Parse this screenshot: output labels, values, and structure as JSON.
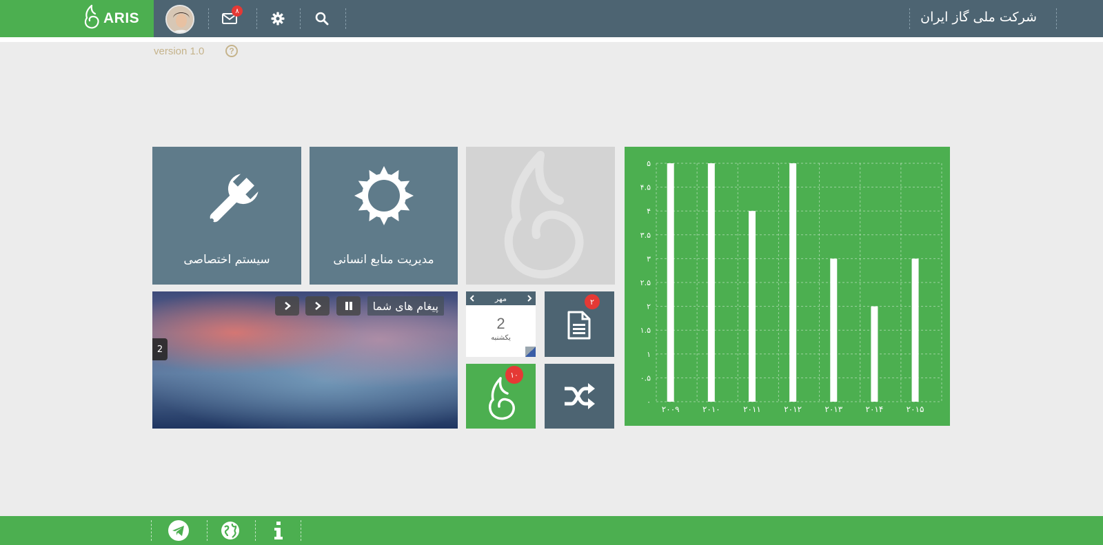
{
  "header": {
    "brand_text": "ARIS",
    "mail_count": "۸",
    "company_name": "شرکت ملی گاز ایران"
  },
  "version": {
    "label": "version 1.0",
    "help_symbol": "?"
  },
  "tiles": {
    "custom_system": {
      "label": "سیستم اختصاصی",
      "icon": "wrench-icon"
    },
    "hr_management": {
      "label": "مدیریت منابع انسانی",
      "icon": "sun-icon"
    },
    "documents": {
      "badge": "۲",
      "icon": "document-icon"
    },
    "aris_app": {
      "badge": "۱۰",
      "icon": "aris-logo-icon"
    },
    "shuffle": {
      "icon": "shuffle-icon"
    }
  },
  "slider": {
    "title": "پیغام های شما",
    "counter": "2"
  },
  "calendar": {
    "month": "مهر",
    "day": "2",
    "weekday": "یکشنبه"
  },
  "chart_data": {
    "type": "bar",
    "categories": [
      "۲۰۰۹",
      "۲۰۱۰",
      "۲۰۱۱",
      "۲۰۱۲",
      "۲۰۱۳",
      "۲۰۱۴",
      "۲۰۱۵"
    ],
    "values": [
      5,
      5,
      4,
      5,
      3,
      2,
      3
    ],
    "ylim": [
      0,
      5
    ],
    "yticks": [
      "۰",
      "۰.۵",
      "۱",
      "۱.۵",
      "۲",
      "۲.۵",
      "۳",
      "۳.۵",
      "۴",
      "۴.۵",
      "۵"
    ],
    "grid": true,
    "bar_color": "#ffffff",
    "background": "#4caf50",
    "title": "",
    "xlabel": "",
    "ylabel": ""
  },
  "footer": {
    "icons": [
      "telegram-icon",
      "globe-icon",
      "info-icon"
    ]
  },
  "colors": {
    "accent_green": "#4caf50",
    "topbar": "#4d6472",
    "tile_blue": "#5f7b8a",
    "badge_red": "#e53935"
  }
}
